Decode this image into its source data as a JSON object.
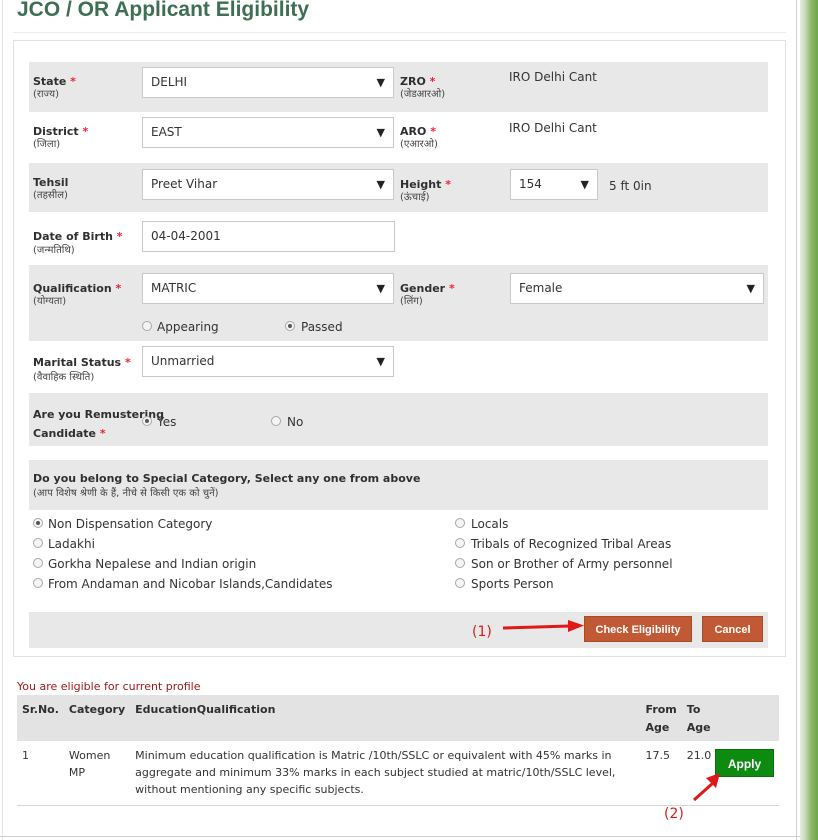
{
  "page": {
    "title": "JCO / OR Applicant Eligibility"
  },
  "form": {
    "state": {
      "label": "State",
      "hindi": "(राज्य)",
      "value": "DELHI"
    },
    "zro": {
      "label": "ZRO",
      "hindi": "(जेडआरओ)",
      "value": "IRO Delhi Cant"
    },
    "district": {
      "label": "District",
      "hindi": "(जिला)",
      "value": "EAST"
    },
    "aro": {
      "label": "ARO",
      "hindi": "(एआरओ)",
      "value": "IRO Delhi Cant"
    },
    "tehsil": {
      "label": "Tehsil",
      "hindi": "(तहसील)",
      "value": "Preet Vihar"
    },
    "height": {
      "label": "Height",
      "hindi": "(ऊंचाई)",
      "value": "154",
      "converted": "5 ft 0in"
    },
    "dob": {
      "label": "Date of Birth",
      "hindi": "(जन्मतिथि)",
      "value": "04-04-2001"
    },
    "qualification": {
      "label": "Qualification",
      "hindi": "(योग्यता)",
      "value": "MATRIC",
      "options": [
        "Appearing",
        "Passed"
      ],
      "selected": "Passed"
    },
    "gender": {
      "label": "Gender",
      "hindi": "(लिंग)",
      "value": "Female"
    },
    "marital": {
      "label": "Marital Status",
      "hindi": "(वैवाहिक स्थिति)",
      "value": "Unmarried"
    },
    "remuster": {
      "label1": "Are you Remustering",
      "label2": "Candidate",
      "options": [
        "Yes",
        "No"
      ],
      "selected": "Yes"
    },
    "special": {
      "title": "Do you belong to Special Category, Select any one from above",
      "hindi": "(आप विशेष श्रेणी के हैं, नीचे से किसी एक को चुनें)",
      "left_options": [
        "Non Dispensation Category",
        "Ladakhi",
        "Gorkha Nepalese and Indian origin",
        "From Andaman and Nicobar Islands,Candidates"
      ],
      "right_options": [
        "Locals",
        "Tribals of Recognized Tribal Areas",
        "Son or Brother of Army personnel",
        "Sports Person"
      ],
      "selected": "Non Dispensation Category"
    },
    "buttons": {
      "check": "Check Eligibility",
      "cancel": "Cancel"
    },
    "required_mark": "*"
  },
  "annotations": {
    "one": "(1)",
    "two": "(2)"
  },
  "results": {
    "message": "You are eligible for current profile",
    "headers": {
      "sr": "Sr.No.",
      "category": "Category",
      "edu": "EducationQualification",
      "from1": "From",
      "from2": "Age",
      "to1": "To",
      "to2": "Age"
    },
    "row": {
      "sr": "1",
      "category1": "Women",
      "category2": "MP",
      "edu": "Minimum education qualification is Matric /10th/SSLC or equivalent with 45% marks in aggregate and minimum 33% marks in each subject studied at matric/10th/SSLC level, without mentioning any specific subjects.",
      "from": "17.5",
      "to": "21.0",
      "apply": "Apply"
    }
  },
  "colors": {
    "accent_brown": "#c15a34",
    "apply_green": "#0d8a10",
    "title_green": "#3e6f54",
    "annotation_red": "#d02020"
  }
}
